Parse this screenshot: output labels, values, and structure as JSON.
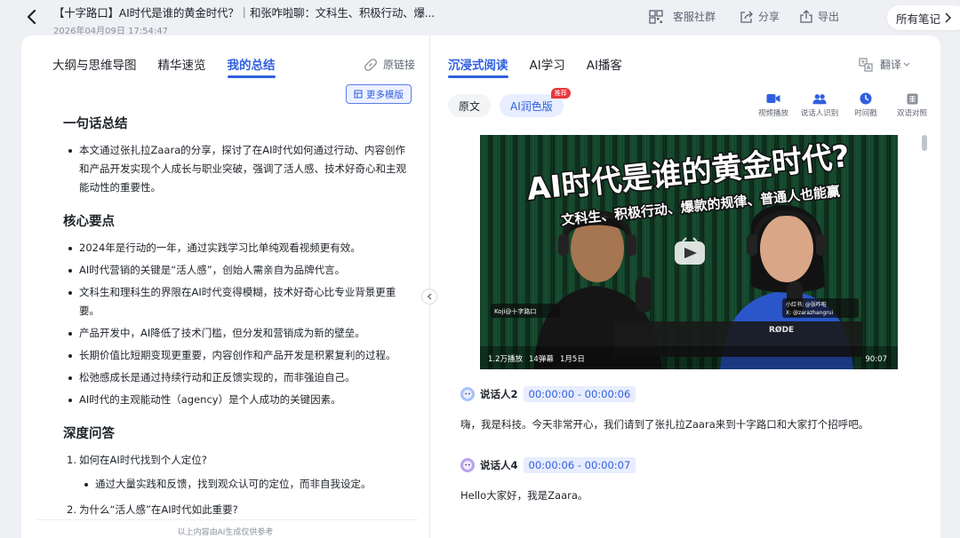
{
  "header": {
    "title": "【十字路口】AI时代是谁的黄金时代？｜和张咋啦聊：文科生、积极行动、爆...",
    "date": "2026年04月09日 17:54:47",
    "community_label": "客服社群",
    "share_label": "分享",
    "export_label": "导出",
    "all_notes_label": "所有笔记"
  },
  "left": {
    "tabs": [
      "大纲与思维导图",
      "精华速览",
      "我的总结"
    ],
    "active_tab": "我的总结",
    "original_link": "原链接",
    "more_templates": "更多模版",
    "one_line": {
      "heading": "一句话总结",
      "items": [
        "本文通过张扎拉Zaara的分享，探讨了在AI时代如何通过行动、内容创作和产品开发实现个人成长与职业突破，强调了活人感、技术好奇心和主观能动性的重要性。"
      ]
    },
    "key_points": {
      "heading": "核心要点",
      "items": [
        "2024年是行动的一年，通过实践学习比单纯观看视频更有效。",
        "AI时代营销的关键是“活人感”，创始人需亲自为品牌代言。",
        "文科生和理科生的界限在AI时代变得模糊，技术好奇心比专业背景更重要。",
        "产品开发中，AI降低了技术门槛，但分发和营销成为新的壁垒。",
        "长期价值比短期变现更重要，内容创作和产品开发是积累复利的过程。",
        "松弛感成长是通过持续行动和正反馈实现的，而非强迫自己。",
        "AI时代的主观能动性（agency）是个人成功的关键因素。"
      ]
    },
    "qa": {
      "heading": "深度问答",
      "q1": "如何在AI时代找到个人定位?",
      "q1_number": "1.",
      "a1": "通过大量实践和反馈，找到观众认可的定位，而非自我设定。",
      "q2": "为什么“活人感”在AI时代如此重要?",
      "q2_number": "2."
    },
    "footer_note": "以上内容由AI生成仅供参考"
  },
  "right": {
    "tabs": [
      "沉浸式阅读",
      "AI学习",
      "AI播客"
    ],
    "active_tab": "沉浸式阅读",
    "translate_label": "翻译",
    "mode_original": "原文",
    "mode_ai": "AI润色版",
    "recommend_badge": "推荐",
    "tools": [
      "视频播放",
      "说话人识别",
      "时间戳",
      "双语对照"
    ],
    "video": {
      "title_line1": "AI时代是谁的黄金时代?",
      "title_line2": "文科生、积极行动、爆款的规律、普通人也能赢",
      "tag_left": "Koji@十字路口",
      "tag_right_1": "小红书: @张咋啦",
      "tag_right_2": "X: @zarazhangrui",
      "plays": "1.2万播放",
      "danmaku": "14弹幕",
      "date": "1月5日",
      "duration": "90:07",
      "mic_brand": "RØDE"
    },
    "transcript": [
      {
        "speaker": "说话人2",
        "time": "00:00:00 - 00:00:06",
        "text": "嗨，我是科技。今天非常开心，我们请到了张扎拉Zaara来到十字路口和大家打个招呼吧。"
      },
      {
        "speaker": "说话人4",
        "time": "00:00:06 - 00:00:07",
        "text": "Hello大家好，我是Zaara。"
      }
    ]
  },
  "colors": {
    "accent": "#2f5fe0",
    "badge_red": "#e8383d",
    "video_title_stroke": "#111111"
  }
}
